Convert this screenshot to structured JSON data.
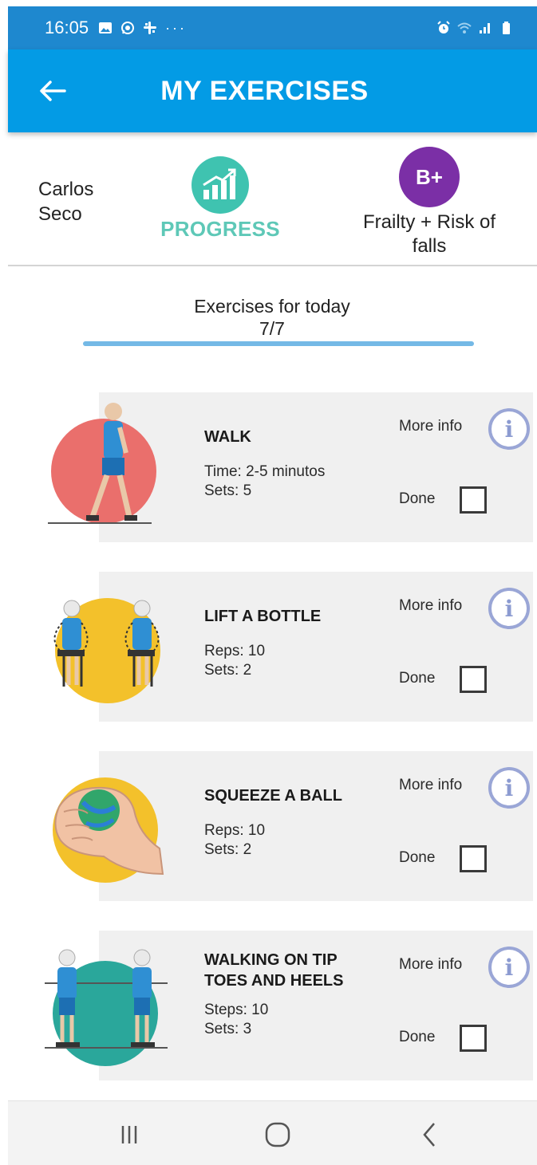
{
  "status_bar": {
    "time": "16:05",
    "left_icons": [
      "gallery-icon",
      "whatsapp-icon",
      "slack-icon",
      "more-dots-icon"
    ],
    "right_icons": [
      "alarm-icon",
      "wifi-icon",
      "signal-icon",
      "battery-icon"
    ]
  },
  "app_bar": {
    "title": "MY EXERCISES",
    "back_icon": "arrow-left-icon"
  },
  "header": {
    "user_name": "Carlos Seco",
    "progress_label": "PROGRESS",
    "grade": "B+",
    "profile_label": "Frailty + Risk of falls"
  },
  "today": {
    "title": "Exercises for today",
    "count": "7/7",
    "completed": 7,
    "total": 7
  },
  "exercises": [
    {
      "title_line1": "WALK",
      "title_line2": "",
      "detail1": "Time: 2-5 minutos",
      "detail2": "Sets: 5",
      "more_info": "More info",
      "done": "Done",
      "image": "walking-person-icon",
      "circle_color": "#ea6f6c"
    },
    {
      "title_line1": "LIFT A BOTTLE",
      "title_line2": "",
      "detail1": "Reps: 10",
      "detail2": "Sets: 2",
      "more_info": "More info",
      "done": "Done",
      "image": "seated-arm-lift-icon",
      "circle_color": "#f3c12b"
    },
    {
      "title_line1": "SQUEEZE A BALL",
      "title_line2": "",
      "detail1": "Reps: 10",
      "detail2": "Sets: 2",
      "more_info": "More info",
      "done": "Done",
      "image": "hand-squeezing-ball-icon",
      "circle_color": "#f3c12b"
    },
    {
      "title_line1": "WALKING ON TIP",
      "title_line2": "TOES AND HEELS",
      "detail1": "Steps: 10",
      "detail2": "Sets: 3",
      "more_info": "More info",
      "done": "Done",
      "image": "tiptoe-heel-walk-icon",
      "circle_color": "#2aa79b"
    }
  ],
  "nav_bar": {
    "icons": [
      "recent-apps-icon",
      "home-icon",
      "back-nav-icon"
    ]
  },
  "colors": {
    "status_bar": "#1e88cf",
    "app_bar": "#039be5",
    "progress": "#3fc3b0",
    "grade": "#7b2fa6",
    "progress_bar": "#74b9e6",
    "card": "#f0f0f0",
    "info_ring": "#9aa6d6"
  }
}
